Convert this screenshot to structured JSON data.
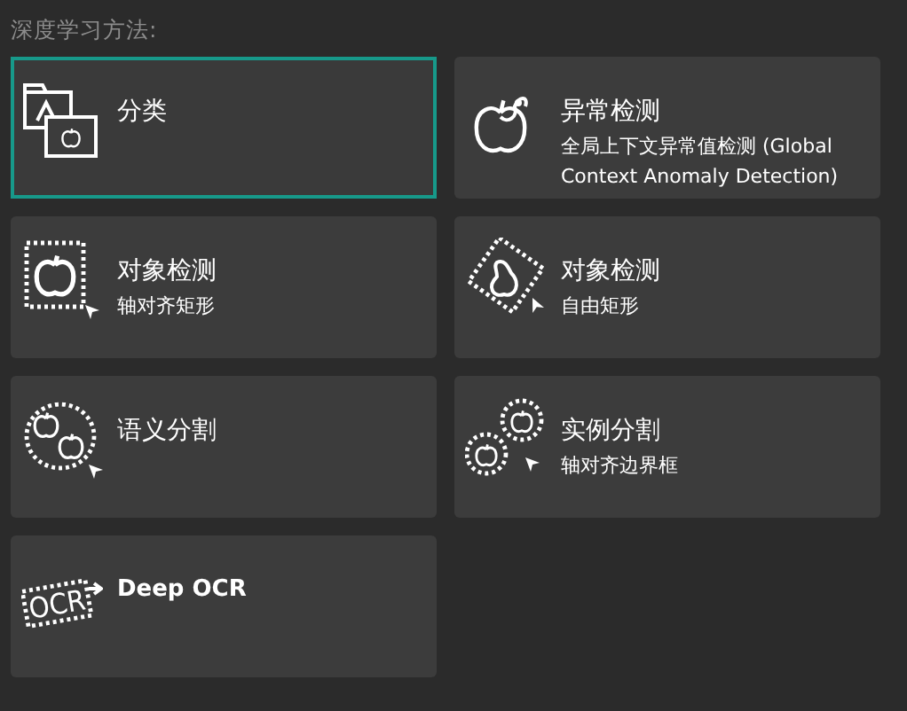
{
  "heading": "深度学习方法:",
  "methods": [
    {
      "title": "分类",
      "kind": "classification",
      "selected": true
    },
    {
      "title": "异常检测",
      "subtitle": "全局上下文异常值检测 (Global Context Anomaly Detection)",
      "kind": "anomaly",
      "selected": false
    },
    {
      "title": "对象检测",
      "subtitle": "轴对齐矩形",
      "kind": "box",
      "selected": false
    },
    {
      "title": "对象检测",
      "subtitle": "自由矩形",
      "kind": "rotated",
      "selected": false
    },
    {
      "title": "语义分割",
      "kind": "semantic",
      "selected": false
    },
    {
      "title": "实例分割",
      "subtitle": "轴对齐边界框",
      "kind": "instance",
      "selected": false
    },
    {
      "title": "Deep OCR",
      "kind": "ocr",
      "icon_text": "OCR",
      "selected": false
    }
  ]
}
